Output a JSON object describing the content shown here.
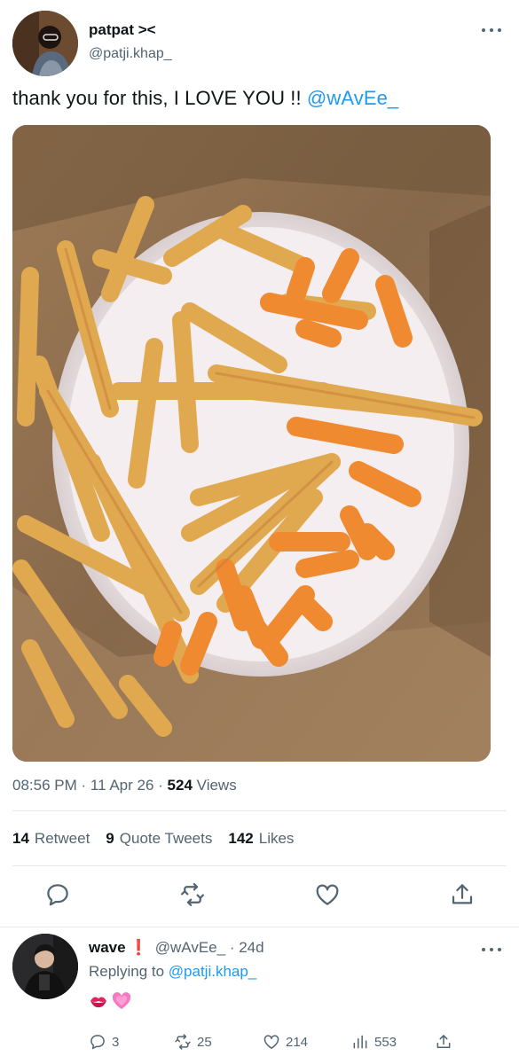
{
  "tweet": {
    "display_name": "patpat ><",
    "handle": "@patji.khap_",
    "text_before": "thank you for this, I LOVE YOU !! ",
    "text_mention": "@wAvEe_",
    "time": "08:56 PM",
    "date": "11 Apr 26",
    "views_count": "524",
    "views_label": "Views",
    "retweets_count": "14",
    "retweets_label": "Retweet",
    "quotes_count": "9",
    "quotes_label": "Quote Tweets",
    "likes_count": "142",
    "likes_label": "Likes",
    "icons": [
      "reply-icon",
      "retweet-icon",
      "like-icon",
      "share-icon",
      "more-icon"
    ]
  },
  "reply": {
    "display_name": "wave",
    "badge": "❗",
    "handle": "@wAvEe_",
    "age": "24d",
    "replying_prefix": "Replying to ",
    "replying_to": "@patji.khap_",
    "emoji": [
      "💋",
      "💗"
    ],
    "reply_count": "3",
    "retweet_count": "25",
    "like_count": "214",
    "view_count": "553"
  },
  "colors": {
    "accent": "#1d9bf0",
    "muted": "#536471",
    "text": "#0f1419",
    "divider": "#e6e9ea"
  }
}
